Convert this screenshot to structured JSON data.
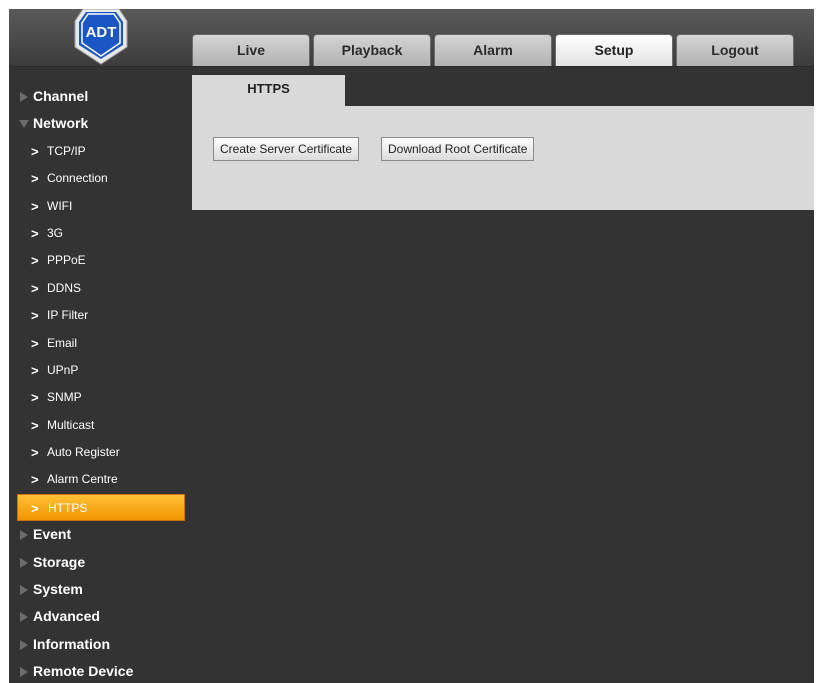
{
  "logo": {
    "text": "ADT"
  },
  "tabs": [
    {
      "label": "Live"
    },
    {
      "label": "Playback"
    },
    {
      "label": "Alarm"
    },
    {
      "label": "Setup",
      "active": true
    },
    {
      "label": "Logout"
    }
  ],
  "sidebar": {
    "categories": {
      "channel": "Channel",
      "network": "Network",
      "event": "Event",
      "storage": "Storage",
      "system": "System",
      "advanced": "Advanced",
      "information": "Information",
      "remote_device": "Remote Device"
    },
    "network_items": [
      "TCP/IP",
      "Connection",
      "WIFI",
      "3G",
      "PPPoE",
      "DDNS",
      "IP Filter",
      "Email",
      "UPnP",
      "SNMP",
      "Multicast",
      "Auto Register",
      "Alarm Centre",
      "HTTPS"
    ],
    "active_item": "HTTPS"
  },
  "content": {
    "tab_label": "HTTPS",
    "create_button": "Create Server Certificate",
    "download_button": "Download Root Certificate"
  },
  "colors": {
    "background": "#333333",
    "active_item": "#f5a000",
    "panel": "#d9d9d9",
    "logo_blue": "#1a56c4"
  },
  "icons": {
    "collapsed": "triangle-right-icon",
    "expanded": "triangle-down-icon",
    "sub_item": "chevron-right-icon"
  }
}
